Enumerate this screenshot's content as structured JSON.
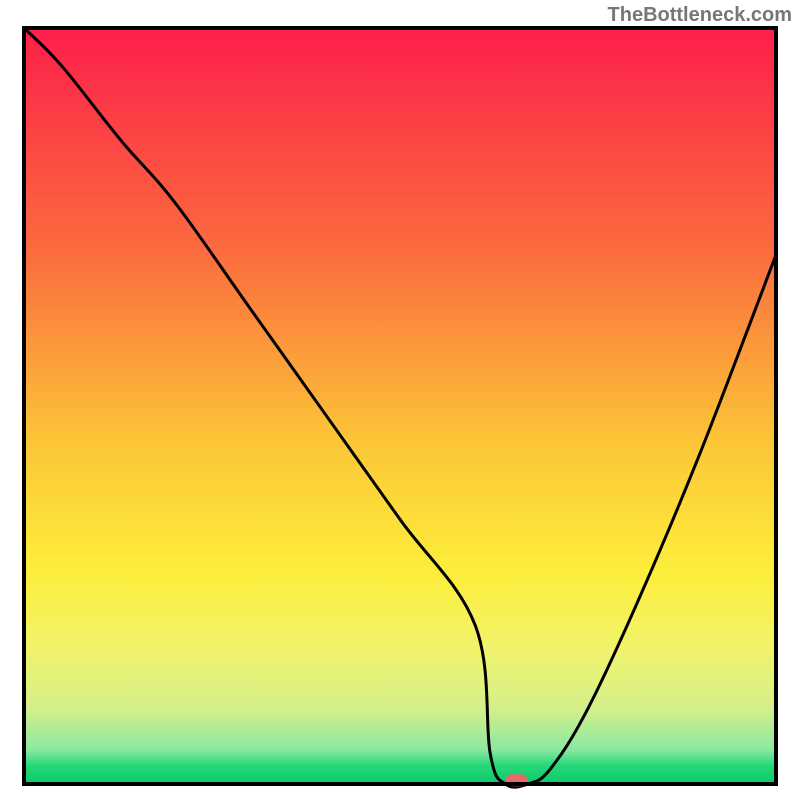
{
  "watermark": "TheBottleneck.com",
  "chart_data": {
    "type": "line",
    "title": "",
    "xlabel": "",
    "ylabel": "",
    "xlim": [
      0,
      100
    ],
    "ylim": [
      0,
      100
    ],
    "series": [
      {
        "name": "bottleneck-curve",
        "x": [
          0,
          5,
          13,
          20,
          30,
          40,
          50,
          60,
          62,
          64,
          67,
          70,
          75,
          82,
          90,
          100
        ],
        "values": [
          100,
          95,
          85,
          77,
          63,
          49,
          35,
          21,
          4,
          0,
          0,
          2,
          10,
          25,
          44,
          70
        ]
      }
    ],
    "marker": {
      "x": 65.5,
      "y": 0.5,
      "shape": "pill",
      "color": "#e66a6a"
    },
    "gradient_stops": [
      {
        "offset": 0.0,
        "color": "#fd1f4a"
      },
      {
        "offset": 0.3,
        "color": "#fb6d3e"
      },
      {
        "offset": 0.55,
        "color": "#fcc637"
      },
      {
        "offset": 0.72,
        "color": "#fdee3b"
      },
      {
        "offset": 0.82,
        "color": "#f1f36b"
      },
      {
        "offset": 0.9,
        "color": "#d4f08a"
      },
      {
        "offset": 0.955,
        "color": "#8be8a0"
      },
      {
        "offset": 0.975,
        "color": "#26d979"
      },
      {
        "offset": 1.0,
        "color": "#0cc86a"
      }
    ],
    "frame": {
      "stroke": "#000000",
      "width": 4
    },
    "curve_style": {
      "stroke": "#000000",
      "width": 3
    }
  }
}
